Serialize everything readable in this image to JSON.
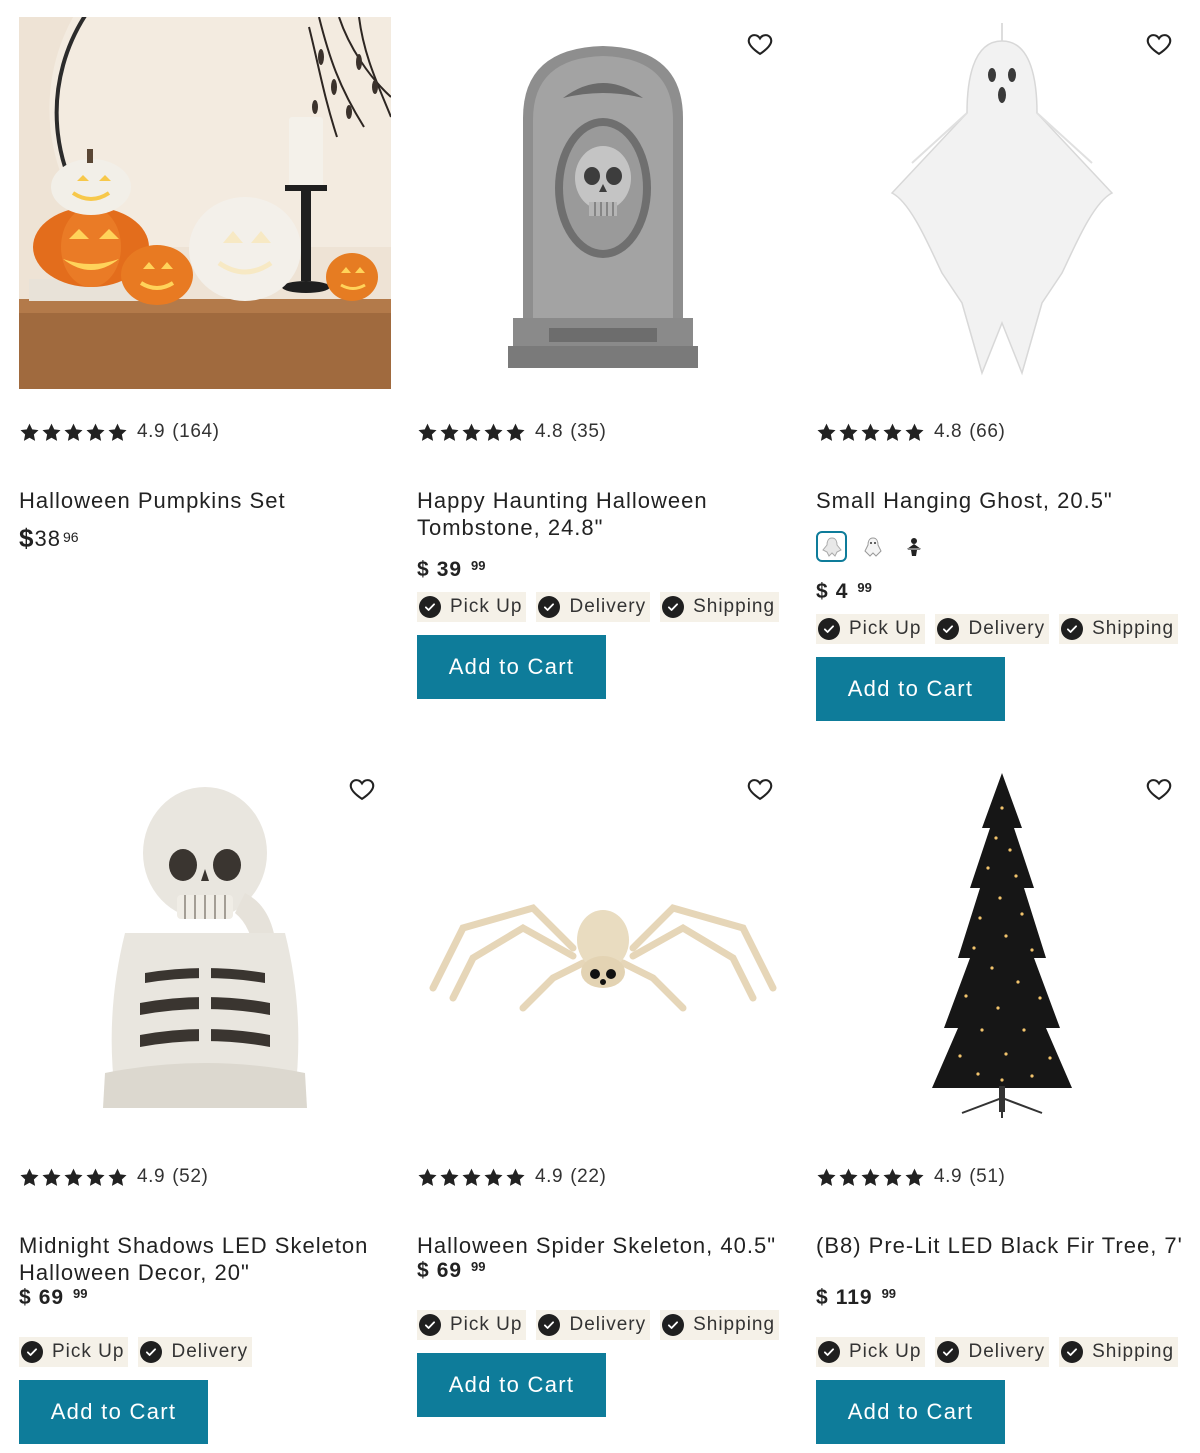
{
  "colors": {
    "accent": "#0e7c9a",
    "pill_bg": "#f5f1e8",
    "check": "#1f1f1f"
  },
  "products": [
    {
      "rating": "4.9",
      "reviews": "(164)",
      "title": "Halloween Pumpkins Set",
      "price_currency": "$",
      "price_dollars": "38",
      "price_cents": "96"
    },
    {
      "rating": "4.8",
      "reviews": "(35)",
      "title": "Happy Haunting Halloween Tombstone, 24.8\"",
      "price_currency": "$",
      "price_dollars": "39",
      "price_cents": "99",
      "fulfillment": [
        "Pick Up",
        "Delivery",
        "Shipping"
      ],
      "cart_label": "Add to Cart"
    },
    {
      "rating": "4.8",
      "reviews": "(66)",
      "title": "Small Hanging Ghost, 20.5\"",
      "price_currency": "$",
      "price_dollars": "4",
      "price_cents": "99",
      "swatches": [
        "white-ghost-swatch",
        "small-ghost-swatch",
        "black-figure-swatch"
      ],
      "fulfillment": [
        "Pick Up",
        "Delivery",
        "Shipping"
      ],
      "cart_label": "Add to Cart"
    },
    {
      "rating": "4.9",
      "reviews": "(52)",
      "title": "Midnight Shadows LED Skeleton Halloween Decor, 20\"",
      "price_currency": "$",
      "price_dollars": "69",
      "price_cents": "99",
      "fulfillment": [
        "Pick Up",
        "Delivery"
      ],
      "cart_label": "Add to Cart"
    },
    {
      "rating": "4.9",
      "reviews": "(22)",
      "title": "Halloween Spider Skeleton, 40.5\"",
      "price_currency": "$",
      "price_dollars": "69",
      "price_cents": "99",
      "fulfillment": [
        "Pick Up",
        "Delivery",
        "Shipping"
      ],
      "cart_label": "Add to Cart"
    },
    {
      "rating": "4.9",
      "reviews": "(51)",
      "title": "(B8) Pre-Lit LED Black Fir Tree, 7'",
      "price_currency": "$",
      "price_dollars": "119",
      "price_cents": "99",
      "fulfillment": [
        "Pick Up",
        "Delivery",
        "Shipping"
      ],
      "cart_label": "Add to Cart"
    }
  ]
}
